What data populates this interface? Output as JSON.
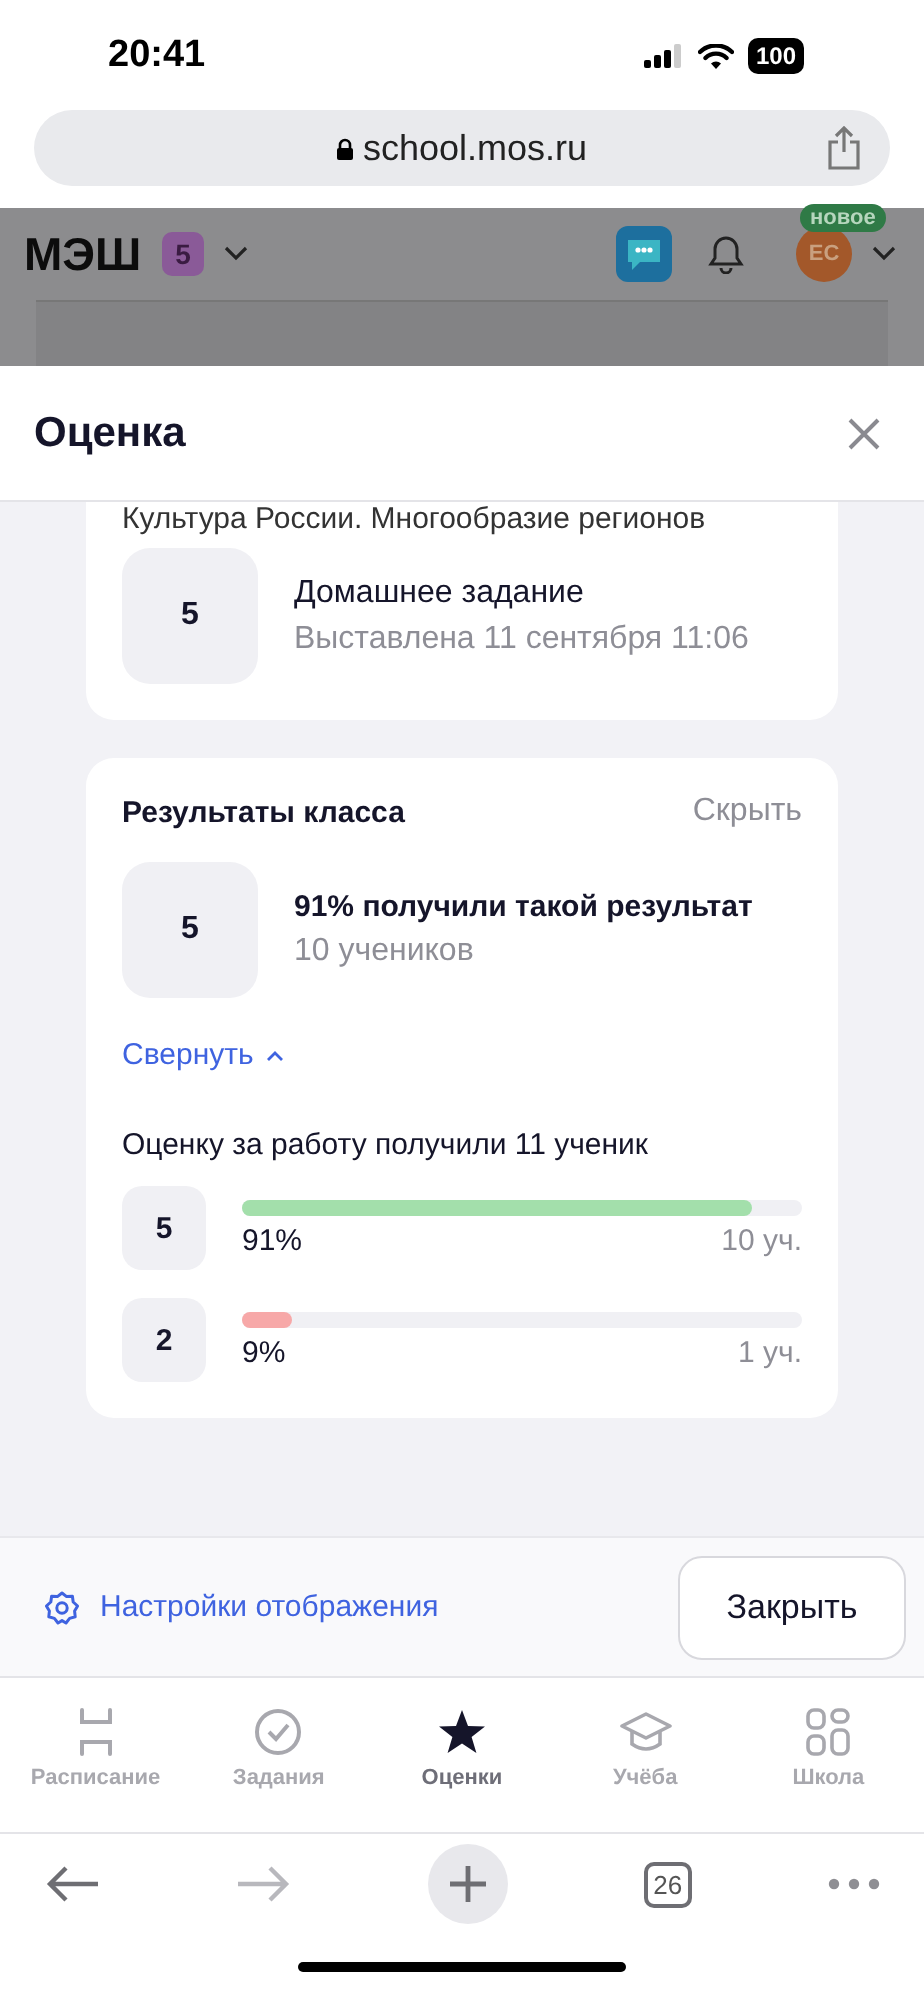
{
  "status_bar": {
    "time": "20:41",
    "battery": "100"
  },
  "browser": {
    "url": "school.mos.ru",
    "tabs_count": "26"
  },
  "site_header": {
    "logo": "МЭШ",
    "grade_badge": "5",
    "avatar_initials": "ЕС",
    "new_badge": "новое"
  },
  "sheet": {
    "title": "Оценка",
    "grade_card": {
      "subject": "Культура России. Многообразие регионов",
      "grade": "5",
      "work_type": "Домашнее задание",
      "issued": "Выставлена 11 сентября 11:06"
    },
    "class_results": {
      "title": "Результаты класса",
      "hide_link": "Скрыть",
      "grade": "5",
      "headline": "91% получили такой результат",
      "count": "10 учеников",
      "collapse_link": "Свернуть",
      "summary": "Оценку за работу получили 11 ученик",
      "distribution": [
        {
          "grade": "5",
          "level": 0.91,
          "percent": "91%",
          "count": "10 уч.",
          "color": "#a3dfab"
        },
        {
          "grade": "2",
          "level": 0.09,
          "percent": "9%",
          "count": "1 уч.",
          "color": "#f7a8a8"
        }
      ]
    },
    "settings_link": "Настройки отображения",
    "close_button": "Закрыть"
  },
  "nav_tabs": [
    {
      "kind": "schedule",
      "label": "Расписание",
      "selected": false
    },
    {
      "kind": "tasks",
      "label": "Задания",
      "selected": false
    },
    {
      "kind": "grades",
      "label": "Оценки",
      "selected": true
    },
    {
      "kind": "study",
      "label": "Учёба",
      "selected": false
    },
    {
      "kind": "school",
      "label": "Школа",
      "selected": false
    }
  ]
}
